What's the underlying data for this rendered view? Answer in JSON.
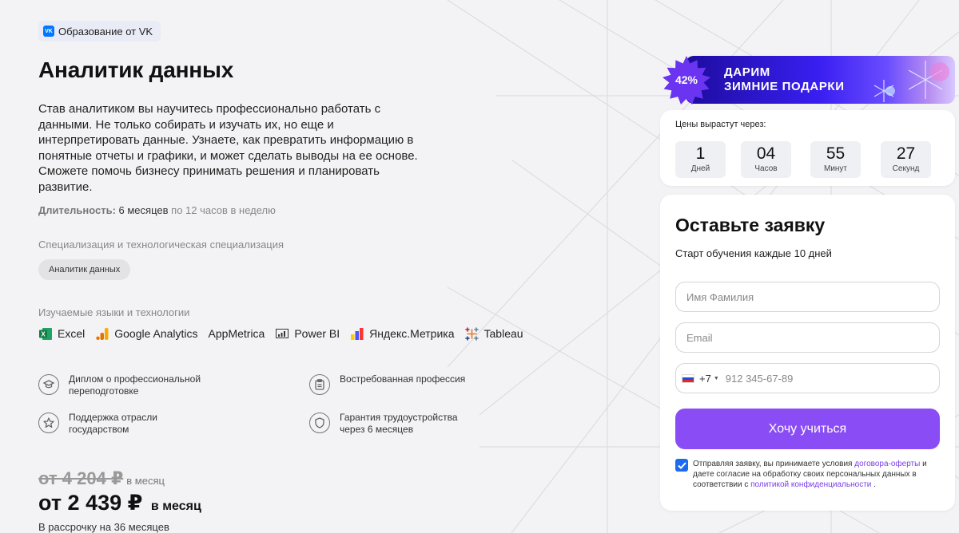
{
  "brand": {
    "badge_text": "Образование от VK",
    "logo_text": "VK"
  },
  "course": {
    "title": "Аналитик данных",
    "description": "Став аналитиком вы научитесь профессионально работать с данными. Не только собирать и изучать их, но еще и интерпретировать данные. Узнаете, как превратить информацию в понятные отчеты и графики, и может сделать выводы на ее основе. Сможете помочь бизнесу принимать решения и планировать развитие.",
    "duration_label": "Длительность:",
    "duration_value": "6 месяцев",
    "duration_note": "по 12 часов в неделю"
  },
  "specialization": {
    "label": "Специализация и технологическая специализация",
    "chip": "Аналитик данных"
  },
  "technologies": {
    "label": "Изучаемые языки и технологии",
    "items": [
      {
        "name": "Excel",
        "icon": "excel-icon"
      },
      {
        "name": "Google Analytics",
        "icon": "google-analytics-icon"
      },
      {
        "name": "AppMetrica",
        "icon": ""
      },
      {
        "name": "Power BI",
        "icon": "power-bi-icon"
      },
      {
        "name": "Яндекс.Метрика",
        "icon": "yandex-metrica-icon"
      },
      {
        "name": "Tableau",
        "icon": "tableau-icon"
      }
    ]
  },
  "features": [
    {
      "text": "Диплом о профессиональной переподготовке",
      "icon": "graduation-cap-icon"
    },
    {
      "text": "Востребованная профессия",
      "icon": "clipboard-icon"
    },
    {
      "text": "Поддержка отрасли государством",
      "icon": "star-icon"
    },
    {
      "text": "Гарантия трудоустройства через 6 месяцев",
      "icon": "shield-icon"
    }
  ],
  "pricing": {
    "old_price": "от 4 204 ₽",
    "old_per": "в месяц",
    "new_price": "от 2 439 ₽",
    "new_per": "в месяц",
    "installment": "В рассрочку на 36 месяцев"
  },
  "promo": {
    "discount": "42%",
    "line1": "ДАРИМ",
    "line2": "ЗИМНИЕ ПОДАРКИ"
  },
  "timer": {
    "title": "Цены вырастут через:",
    "units": [
      {
        "value": "1",
        "label": "Дней"
      },
      {
        "value": "04",
        "label": "Часов"
      },
      {
        "value": "55",
        "label": "Минут"
      },
      {
        "value": "27",
        "label": "Секунд"
      }
    ]
  },
  "form": {
    "title": "Оставьте заявку",
    "subtitle": "Старт обучения каждые 10 дней",
    "name_placeholder": "Имя Фамилия",
    "email_placeholder": "Email",
    "country_code": "+7",
    "phone_placeholder": "912 345-67-89",
    "submit_label": "Хочу учиться",
    "consent_checked": true,
    "consent_part1": "Отправляя заявку, вы принимаете условия ",
    "consent_link1": "договора-оферты",
    "consent_part2": " и даете согласие на обработку своих персональных данных в соответствии с ",
    "consent_link2": "политикой конфиденциальности",
    "consent_part3": " ."
  },
  "colors": {
    "accent": "#8a4cf4",
    "checkbox": "#1a6bf2",
    "link": "#7a3ee8",
    "vk_blue": "#0077ff",
    "promo_star": "#6a34f0"
  }
}
